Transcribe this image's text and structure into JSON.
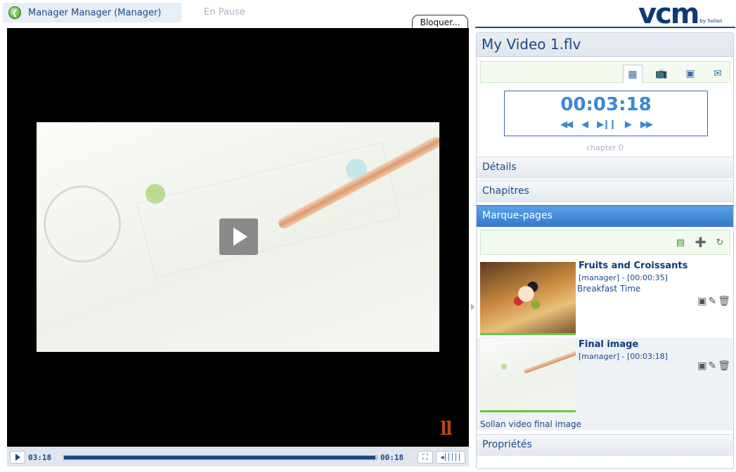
{
  "topbar": {
    "user_label": "Manager Manager (Manager)",
    "status": "En Pause",
    "lock_button": "Bloquer..."
  },
  "brand": {
    "name": "vcm",
    "by": "by Sollan"
  },
  "player": {
    "current_time": "03:18",
    "remaining_time": "00:18",
    "progress_percent": 99.5
  },
  "panel": {
    "title": "My Video 1.flv",
    "view_tabs": [
      {
        "name": "remote",
        "icon": "remote-icon",
        "active": true
      },
      {
        "name": "tv",
        "icon": "tv-icon",
        "active": false
      },
      {
        "name": "camera",
        "icon": "camera-icon",
        "active": false
      },
      {
        "name": "mail",
        "icon": "mail-icon",
        "active": false
      }
    ],
    "timecode": "00:03:18",
    "chapter": "chapter 0",
    "sections": {
      "details": "Détails",
      "chapters": "Chapitres",
      "bookmarks": "Marque-pages",
      "properties": "Propriétés"
    },
    "bookmarks": [
      {
        "title": "Fruits and Croissants",
        "meta": "[manager] - [00:00:35]",
        "description": "Breakfast Time"
      },
      {
        "title": "Final image",
        "meta": "[manager] - [00:03:18]",
        "description": "Sollan video final image"
      }
    ]
  },
  "colors": {
    "accent": "#1a4a86",
    "active_section": "#3479c8",
    "progress_green": "#5ccd3c"
  }
}
